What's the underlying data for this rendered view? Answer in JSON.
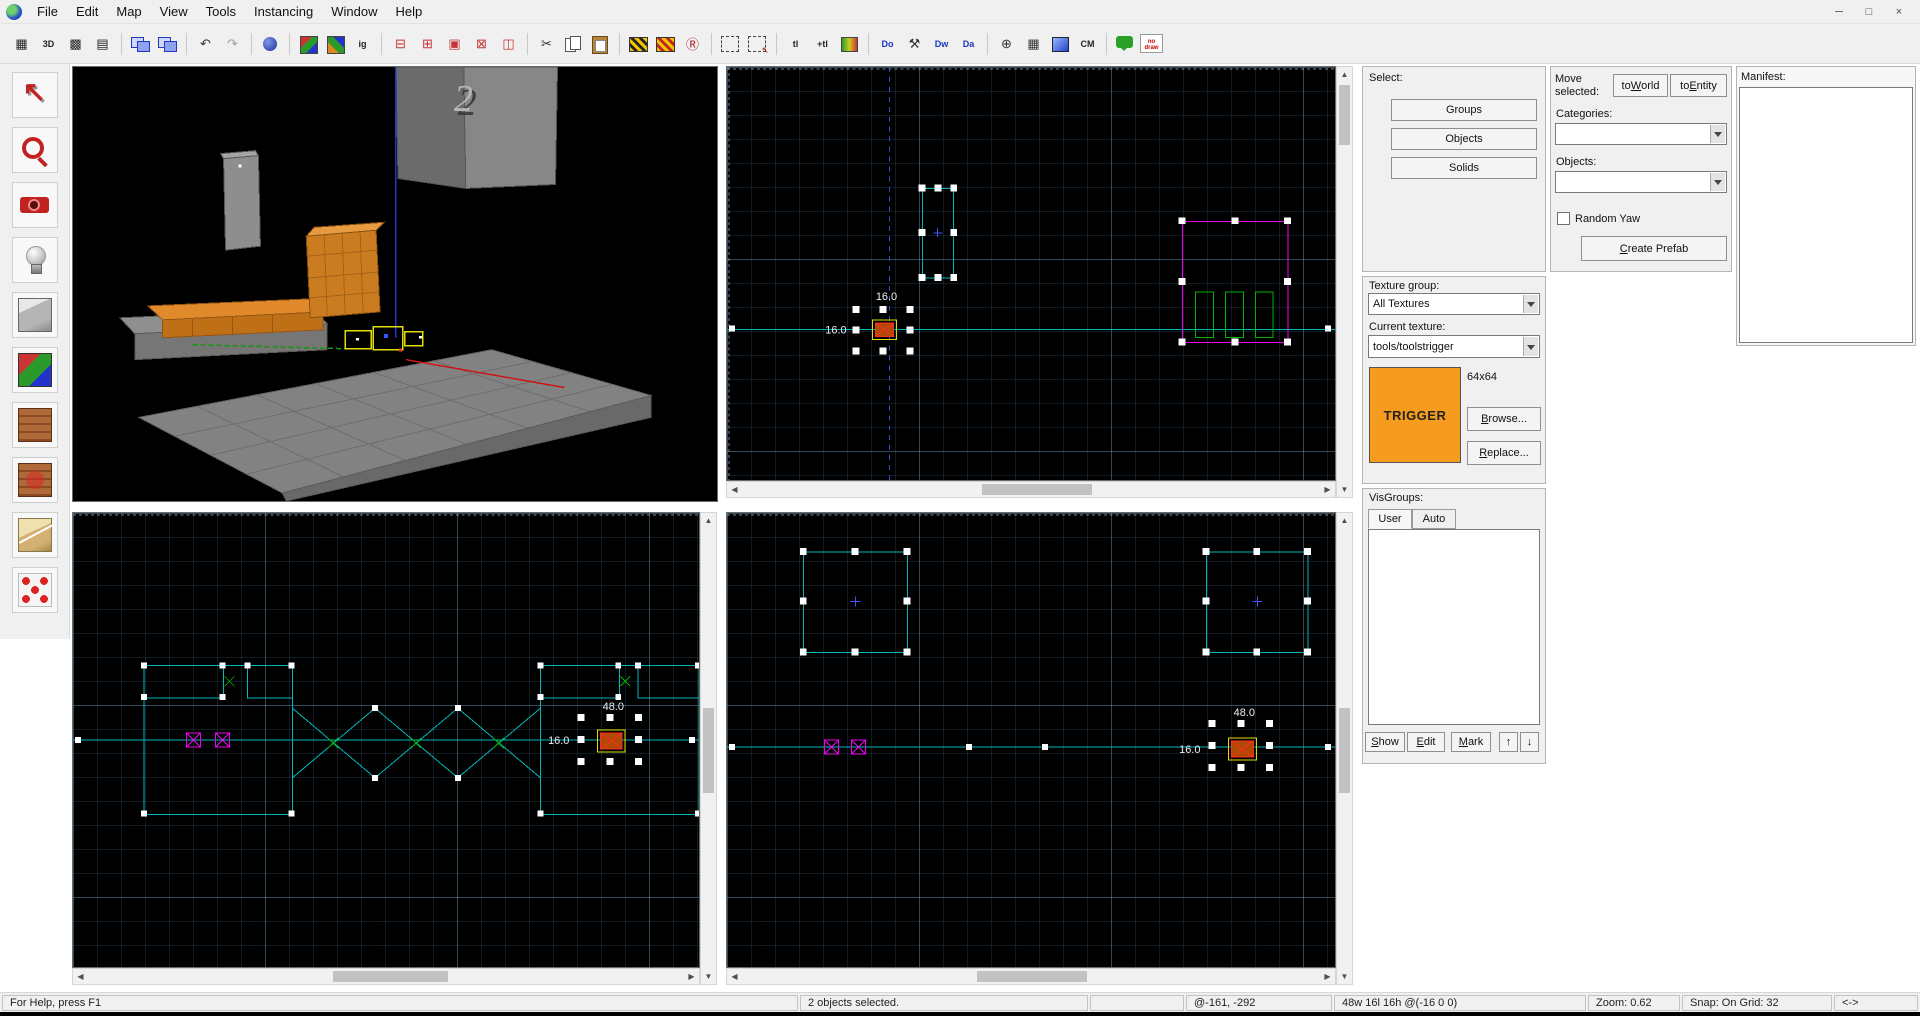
{
  "menu": {
    "items": [
      "File",
      "Edit",
      "Map",
      "View",
      "Tools",
      "Instancing",
      "Window",
      "Help"
    ],
    "window_controls": {
      "minimize": "─",
      "maximize": "□",
      "close": "×"
    }
  },
  "toolbar": {
    "icons": [
      {
        "name": "toggle-grid-icon",
        "g": "▦",
        "c": "#222222"
      },
      {
        "name": "toggle-3d-grid-icon",
        "g": "3D",
        "c": "#222222",
        "cls": "txt"
      },
      {
        "name": "smaller-grid-icon",
        "g": "▩",
        "c": "#222222"
      },
      {
        "name": "larger-grid-icon",
        "g": "▤",
        "c": "#222222"
      },
      {
        "sep": true
      },
      {
        "name": "load-window-state-icon",
        "cls": "win2"
      },
      {
        "name": "save-window-state-icon",
        "cls": "win2"
      },
      {
        "sep": true
      },
      {
        "name": "undo-icon",
        "g": "↶",
        "c": "#333333"
      },
      {
        "name": "redo-icon",
        "g": "↷",
        "c": "#a0a0a0"
      },
      {
        "sep": true
      },
      {
        "name": "run-map-icon",
        "cls": "runmap"
      },
      {
        "sep": true
      },
      {
        "name": "texture-lock-icon",
        "cls": "cubergb"
      },
      {
        "name": "texture-scale-lock-icon",
        "cls": "cubergb2"
      },
      {
        "name": "ignore-groups-icon",
        "g": "ig",
        "c": "#222222",
        "cls": "txt"
      },
      {
        "sep": true
      },
      {
        "name": "carve-icon",
        "g": "⊟",
        "c": "#c23535"
      },
      {
        "name": "hollow-icon",
        "g": "⊞",
        "c": "#c23535"
      },
      {
        "name": "group-icon",
        "g": "▣",
        "c": "#c23535"
      },
      {
        "name": "ungroup-icon",
        "g": "⊠",
        "c": "#c23535"
      },
      {
        "name": "toggle-group-ignore-icon",
        "g": "◫",
        "c": "#c23535"
      },
      {
        "sep": true
      },
      {
        "name": "cut-icon",
        "g": "✂",
        "c": "#333333"
      },
      {
        "name": "copy-icon",
        "cls": "copy"
      },
      {
        "name": "paste-icon",
        "cls": "paste"
      },
      {
        "sep": true
      },
      {
        "name": "texture-application-icon",
        "cls": "hazard"
      },
      {
        "name": "replace-textures-icon",
        "cls": "hazard2"
      },
      {
        "name": "radius-culling-icon",
        "g": "Ⓡ",
        "c": "#b02020"
      },
      {
        "sep": true
      },
      {
        "name": "select-box-icon",
        "cls": "dashbox"
      },
      {
        "name": "magnify-selection-icon",
        "cls": "dashbox2"
      },
      {
        "sep": true
      },
      {
        "name": "texture-lock-toggle-icon",
        "g": "tl",
        "c": "#222222",
        "cls": "txt"
      },
      {
        "name": "texture-scaling-toggle-icon",
        "g": "+tl",
        "c": "#222222",
        "cls": "txt"
      },
      {
        "name": "fade-preview-icon",
        "cls": "paint"
      },
      {
        "sep": true
      },
      {
        "name": "display-objects-icon",
        "g": "Do",
        "c": "#1a35c0",
        "cls": "txt"
      },
      {
        "name": "sculpt-tool-icon",
        "g": "⚒",
        "c": "#333333"
      },
      {
        "name": "display-walkable-icon",
        "g": "Dw",
        "c": "#1a35c0",
        "cls": "txt"
      },
      {
        "name": "display-areas-icon",
        "g": "Da",
        "c": "#1a35c0",
        "cls": "txt"
      },
      {
        "sep": true
      },
      {
        "name": "sphere-grid-icon",
        "g": "⊕",
        "c": "#333333"
      },
      {
        "name": "overlay-grid-icon",
        "g": "▦",
        "c": "#333333"
      },
      {
        "name": "model-render-icon",
        "cls": "bluebox"
      },
      {
        "name": "center-models-icon",
        "g": "CM",
        "c": "#222222",
        "cls": "txt"
      },
      {
        "sep": true
      },
      {
        "name": "chat-icon",
        "cls": "chat"
      },
      {
        "name": "no-draw-icon",
        "g": "no draw",
        "cls": "nodraw"
      }
    ]
  },
  "tool_palette": {
    "icons": [
      {
        "name": "selection-tool-icon",
        "kind": "arrow"
      },
      {
        "name": "magnify-tool-icon",
        "kind": "magnify"
      },
      {
        "name": "camera-tool-icon",
        "kind": "camera"
      },
      {
        "name": "entity-tool-icon",
        "kind": "entity"
      },
      {
        "name": "block-tool-icon",
        "kind": "block"
      },
      {
        "name": "texture-application-tool-icon",
        "kind": "texapply"
      },
      {
        "name": "apply-current-texture-icon",
        "kind": "brick"
      },
      {
        "name": "apply-decals-icon",
        "kind": "brick2"
      },
      {
        "name": "clipping-tool-icon",
        "kind": "clip"
      },
      {
        "name": "vertex-tool-icon",
        "kind": "vertex"
      }
    ]
  },
  "viewports": {
    "top": {
      "w_label": "16.0",
      "h_label": "16.0"
    },
    "front": {
      "w_label": "48.0",
      "h_label": "16.0"
    },
    "side": {
      "w_label": "48.0",
      "h_label": "16.0"
    },
    "three_d": {
      "numeral": "2"
    }
  },
  "object_bar": {
    "select_label": "Select:",
    "groups_label": "Groups",
    "objects_btn_label": "Objects",
    "solids_label": "Solids",
    "move_label": "Move selected:",
    "to_world": {
      "pre": "to",
      "key": "W",
      "post": "orld"
    },
    "to_entity": {
      "pre": "to",
      "key": "E",
      "post": "ntity"
    },
    "categories_label": "Categories:",
    "objects_label": "Objects:",
    "random_yaw_label": "Random Yaw",
    "create_prefab": {
      "pre": "",
      "key": "C",
      "post": "reate Prefab"
    },
    "manifest_label": "Manifest:"
  },
  "texture_bar": {
    "group_label": "Texture group:",
    "group_value": "All Textures",
    "current_label": "Current texture:",
    "current_value": "tools/toolstrigger",
    "texture_text": "TRIGGER",
    "size_label": "64x64",
    "browse": {
      "pre": "",
      "key": "B",
      "post": "rowse..."
    },
    "replace": {
      "pre": "",
      "key": "R",
      "post": "eplace..."
    }
  },
  "visgroups": {
    "title": "VisGroups:",
    "tabs": [
      "User",
      "Auto"
    ],
    "show": {
      "pre": "",
      "key": "S",
      "post": "how"
    },
    "edit": {
      "pre": "",
      "key": "E",
      "post": "dit"
    },
    "mark": {
      "pre": "",
      "key": "M",
      "post": "ark"
    },
    "up_arrow": "↑",
    "down_arrow": "↓"
  },
  "status_bar": {
    "help": "For Help, press F1",
    "selection": "2 objects selected.",
    "coordinates": "@-161, -292",
    "dimensions": "48w 16l 16h @(-16 0 0)",
    "zoom": "Zoom: 0.62",
    "snap": "Snap: On Grid: 32",
    "nav": "<->"
  },
  "colors": {
    "trigger_orange": "#f59b1e",
    "geometry_teal": "#00b8b8",
    "selection_magenta": "#ee00ee",
    "selection_handle": "#ffffff",
    "selection_yellow": "#e0e000",
    "grid_line": "#2d5977"
  }
}
